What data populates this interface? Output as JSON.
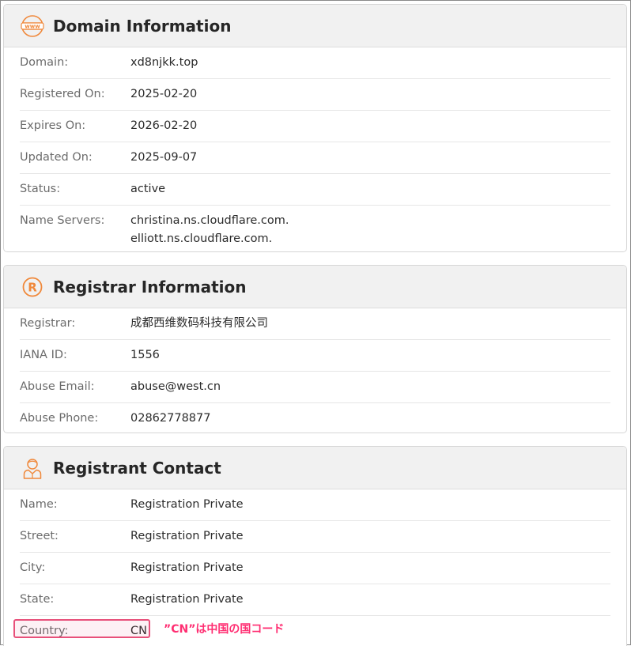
{
  "domain_info": {
    "title": "Domain Information",
    "icon": "www-icon",
    "rows": [
      {
        "label": "Domain:",
        "value": "xd8njkk.top"
      },
      {
        "label": "Registered On:",
        "value": "2025-02-20"
      },
      {
        "label": "Expires On:",
        "value": "2026-02-20"
      },
      {
        "label": "Updated On:",
        "value": "2025-09-07"
      },
      {
        "label": "Status:",
        "value": "active"
      },
      {
        "label": "Name Servers:",
        "values": [
          "christina.ns.cloudflare.com.",
          "elliott.ns.cloudflare.com."
        ]
      }
    ]
  },
  "registrar_info": {
    "title": "Registrar Information",
    "icon": "registered-icon",
    "rows": [
      {
        "label": "Registrar:",
        "value": "成都西维数码科技有限公司"
      },
      {
        "label": "IANA ID:",
        "value": "1556"
      },
      {
        "label": "Abuse Email:",
        "value": "abuse@west.cn"
      },
      {
        "label": "Abuse Phone:",
        "value": "02862778877"
      }
    ]
  },
  "registrant_contact": {
    "title": "Registrant Contact",
    "icon": "person-icon",
    "rows": [
      {
        "label": "Name:",
        "value": "Registration Private"
      },
      {
        "label": "Street:",
        "value": "Registration Private"
      },
      {
        "label": "City:",
        "value": "Registration Private"
      },
      {
        "label": "State:",
        "value": "Registration Private"
      },
      {
        "label": "Country:",
        "value": "CN"
      }
    ]
  },
  "annotation": {
    "text": "”CN”は中国の国コード",
    "color": "#ff2e72"
  },
  "colors": {
    "icon_orange": "#f0883a",
    "header_bg": "#f1f1f1",
    "highlight": "#e8507a"
  }
}
